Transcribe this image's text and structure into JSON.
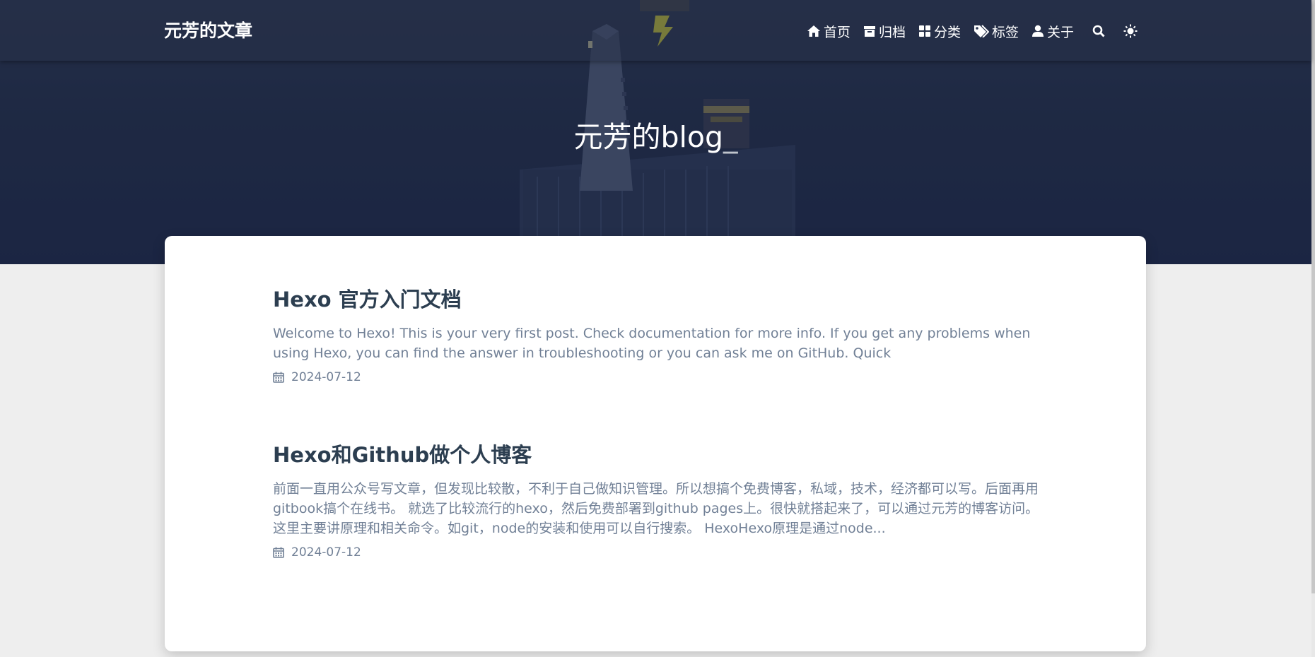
{
  "header": {
    "brand": "元芳的文章",
    "nav": [
      {
        "label": "首页",
        "icon": "home-icon"
      },
      {
        "label": "归档",
        "icon": "archive-icon"
      },
      {
        "label": "分类",
        "icon": "category-icon"
      },
      {
        "label": "标签",
        "icon": "tags-icon"
      },
      {
        "label": "关于",
        "icon": "user-icon"
      }
    ],
    "search_icon": "search-icon",
    "theme_icon": "sun-icon"
  },
  "hero": {
    "title": "元芳的blog",
    "cursor": "_"
  },
  "posts": [
    {
      "title": "Hexo 官方入门文档",
      "excerpt": "Welcome to Hexo! This is your very first post. Check documentation for more info. If you get any problems when using Hexo, you can find the answer in troubleshooting or you can ask me on GitHub. Quick",
      "date": "2024-07-12",
      "date_icon": "calendar-icon"
    },
    {
      "title": "Hexo和Github做个人博客",
      "excerpt": "前面一直用公众号写文章，但发现比较散，不利于自己做知识管理。所以想搞个免费博客，私域，技术，经济都可以写。后面再用gitbook搞个在线书。 就选了比较流行的hexo，然后免费部署到github pages上。很快就搭起来了，可以通过元芳的博客访问。 这里主要讲原理和相关命令。如git，node的安装和使用可以自行搜索。 HexoHexo原理是通过node...",
      "date": "2024-07-12",
      "date_icon": "calendar-icon"
    }
  ],
  "colors": {
    "banner": "#1f2a44",
    "title_text": "#2c3e50",
    "muted_text": "#718096",
    "page_bg": "#eeeeee"
  }
}
